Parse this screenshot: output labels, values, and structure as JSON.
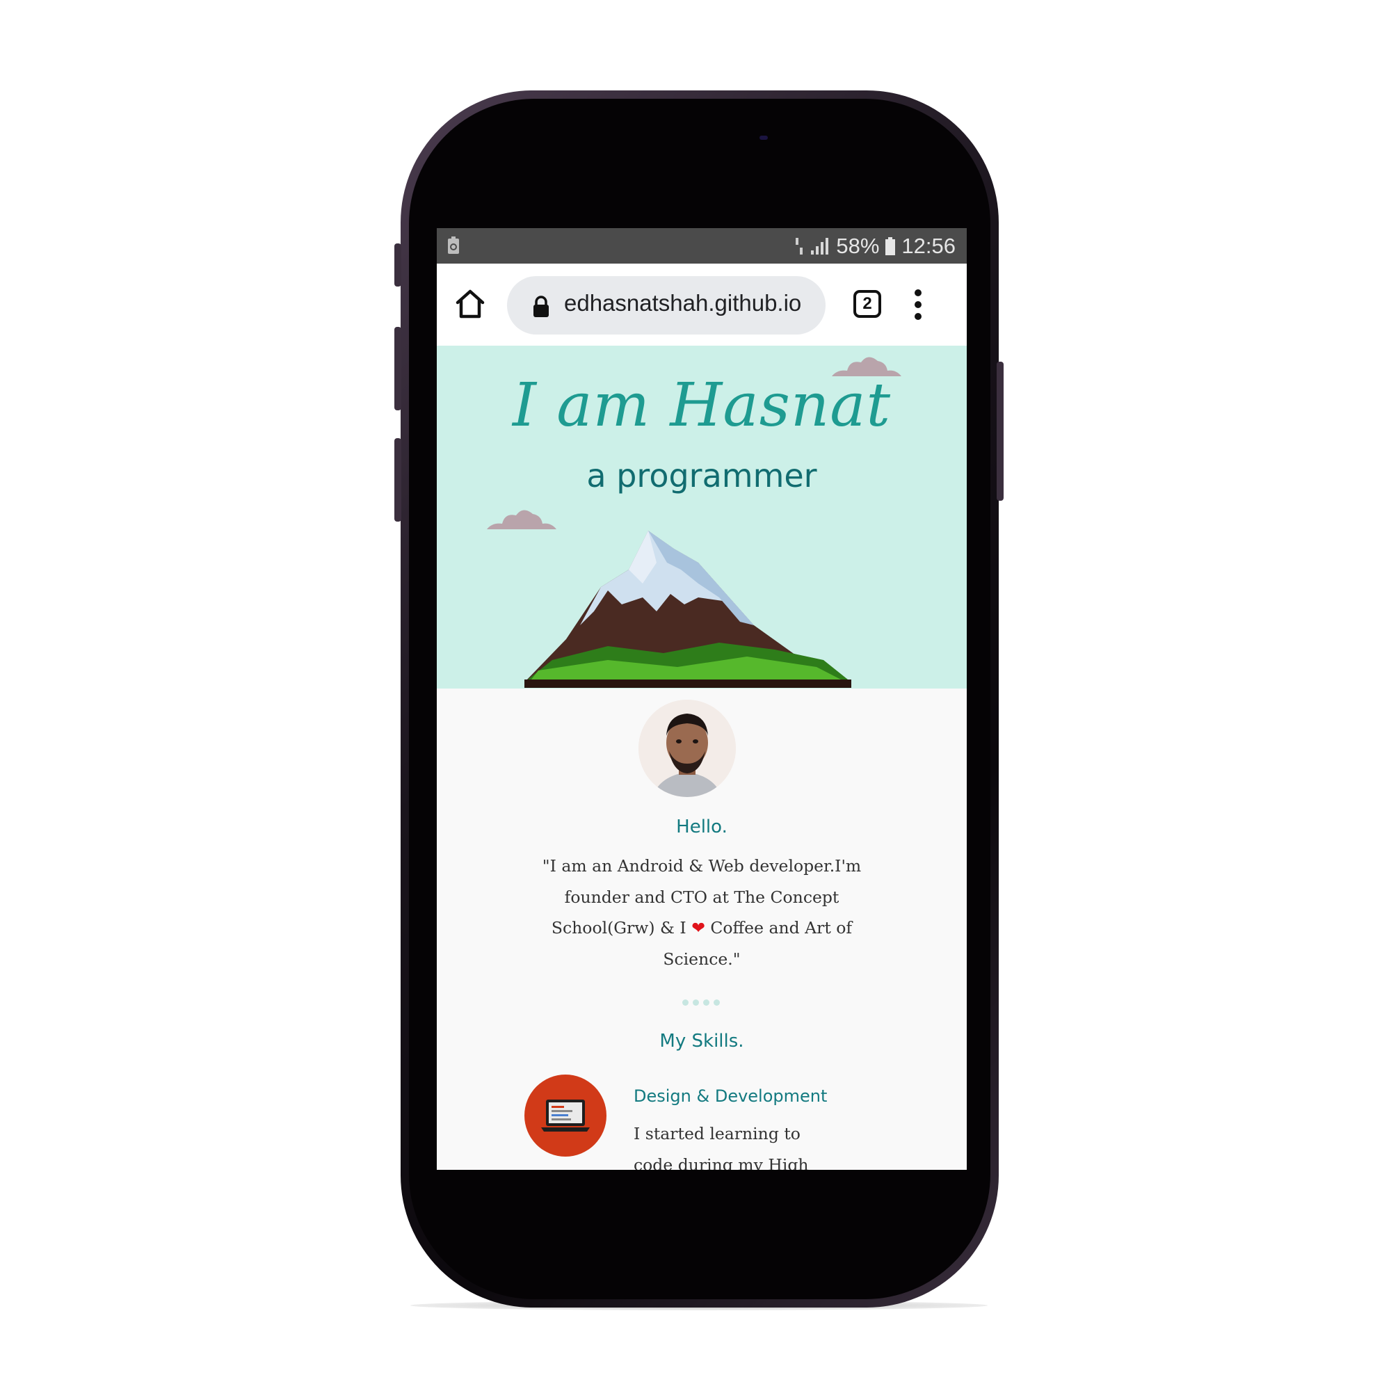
{
  "status_bar": {
    "battery": "58%",
    "time": "12:56"
  },
  "browser": {
    "url": "edhasnatshah.github.io",
    "tab_count": "2"
  },
  "hero": {
    "title": "I am Hasnat",
    "subtitle": "a programmer"
  },
  "about": {
    "heading": "Hello.",
    "intro_before": "\"I am an Android & Web developer.I'm founder and CTO at The Concept School(Grw) & I ",
    "heart": "❤",
    "intro_after": " Coffee and Art of Science.\""
  },
  "skills": {
    "heading": "My Skills.",
    "items": [
      {
        "title": "Design & Development",
        "text": "I started learning to code during my High School",
        "icon": "laptop-icon"
      }
    ]
  },
  "colors": {
    "accent": "#137a80",
    "hero_bg": "#ccf0e8",
    "skill_icon_bg": "#d13a18"
  }
}
